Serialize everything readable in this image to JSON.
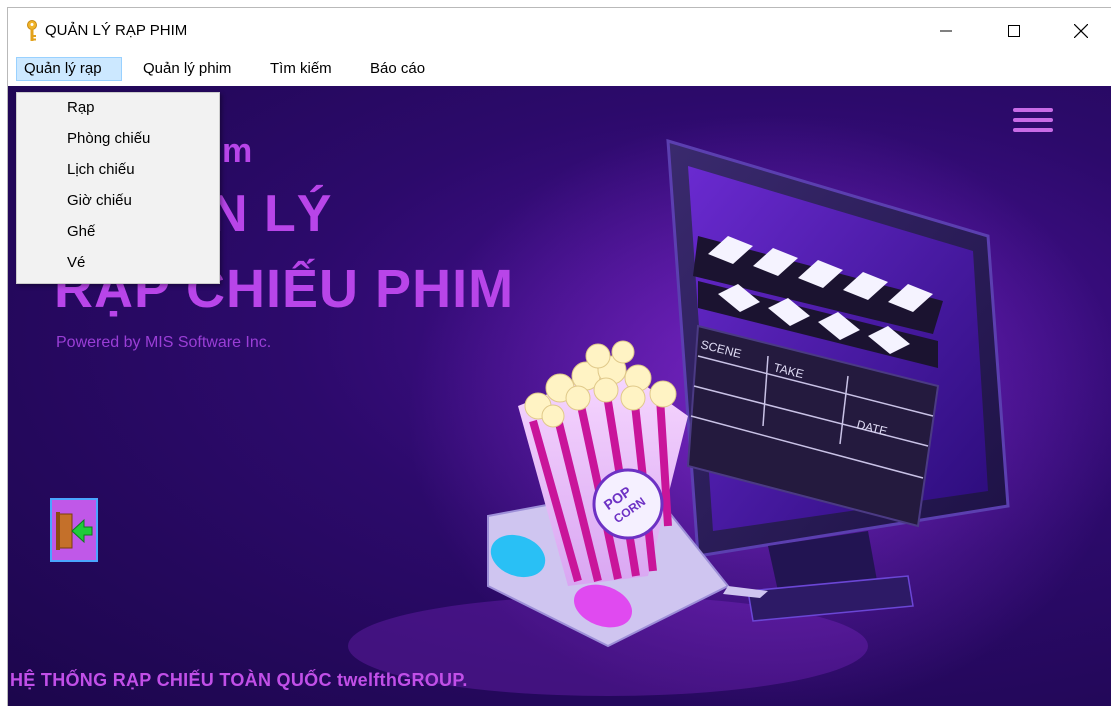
{
  "window": {
    "title": "QUẢN LÝ RẠP PHIM"
  },
  "menubar": {
    "items": [
      {
        "label": "Quản lý rạp"
      },
      {
        "label": "Quản lý phim"
      },
      {
        "label": "Tìm kiếm"
      },
      {
        "label": "Báo cáo"
      }
    ],
    "active_index": 0
  },
  "dropdown": {
    "items": [
      {
        "label": "Rạp"
      },
      {
        "label": "Phòng chiếu"
      },
      {
        "label": "Lịch chiếu"
      },
      {
        "label": "Giờ chiếu"
      },
      {
        "label": "Ghế"
      },
      {
        "label": "Vé"
      }
    ]
  },
  "hero": {
    "line1_partial": "m",
    "line2_partial": "N LÝ",
    "line3": "RẠP CHIẾU PHIM",
    "powered_by": "Powered by MIS Software Inc."
  },
  "illustration": {
    "clapper_scene": "SCENE",
    "clapper_take": "TAKE",
    "clapper_date": "DATE",
    "popcorn_label_1": "POP",
    "popcorn_label_2": "CORN"
  },
  "footer": {
    "text": "HỆ THỐNG RẠP CHIẾU TOÀN QUỐC twelfthGROUP."
  },
  "icons": {
    "app": "key-icon",
    "minimize": "minimize-icon",
    "maximize": "maximize-icon",
    "close": "close-icon",
    "hamburger": "hamburger-menu-icon",
    "exit": "exit-door-icon"
  },
  "colors": {
    "accent_text": "#b845e9",
    "background_dark": "#1c064c",
    "menu_highlight": "#cce8ff"
  }
}
